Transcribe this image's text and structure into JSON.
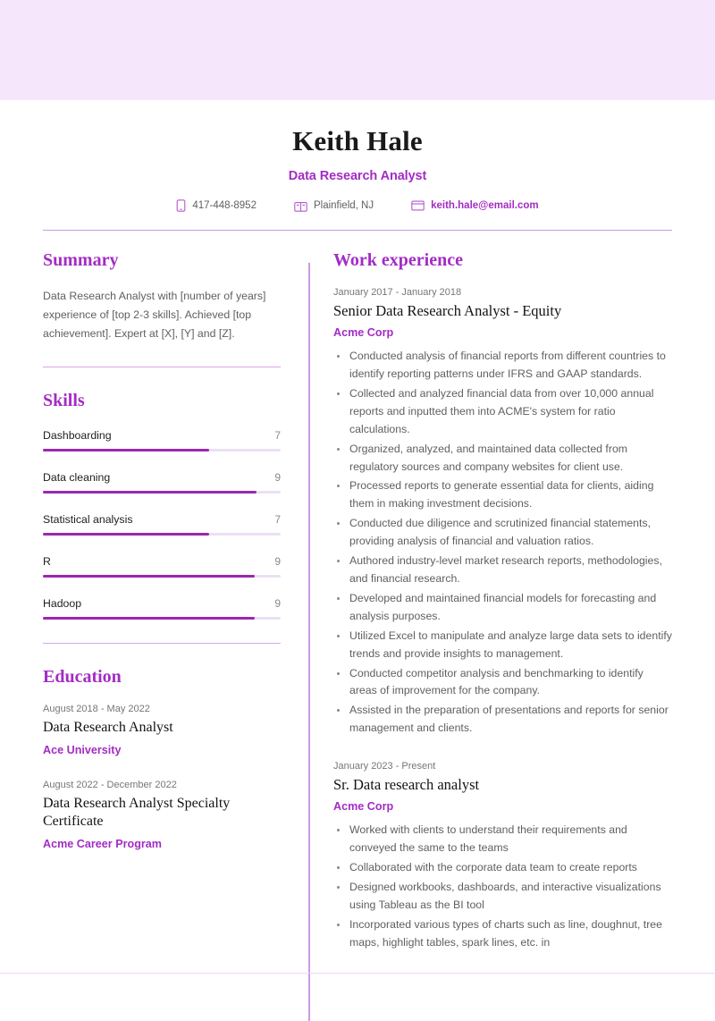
{
  "theme": {
    "accent": "#a32cc4",
    "bar_fill": "#9c27b0",
    "bar_track": "#ece0f3",
    "banner_bg": "#f6e6fb",
    "divider": "#cc9ae0",
    "body_text": "#5f5f5f"
  },
  "header": {
    "full_name": "Keith Hale",
    "job_title": "Data Research Analyst",
    "contacts": [
      {
        "icon": "phone-icon",
        "text": "417-448-8952",
        "accent": false
      },
      {
        "icon": "location-icon",
        "text": "Plainfield, NJ",
        "accent": false
      },
      {
        "icon": "email-icon",
        "text": "keith.hale@email.com",
        "accent": true
      }
    ]
  },
  "summary": {
    "title": "Summary",
    "text": "Data Research Analyst with [number of years] experience of [top 2-3 skills]. Achieved [top achievement]. Expert at [X], [Y] and [Z]."
  },
  "skills": {
    "title": "Skills",
    "max": 10,
    "items": [
      {
        "name": "Dashboarding",
        "value": "7",
        "percent": 70
      },
      {
        "name": "Data cleaning",
        "value": "9",
        "percent": 90
      },
      {
        "name": "Statistical analysis",
        "value": "7",
        "percent": 70
      },
      {
        "name": "R",
        "value": "9",
        "percent": 89
      },
      {
        "name": "Hadoop",
        "value": "9",
        "percent": 89
      }
    ]
  },
  "education": {
    "title": "Education",
    "items": [
      {
        "date": "August 2018 - May 2022",
        "title": "Data Research Analyst",
        "org": "Ace University"
      },
      {
        "date": "August 2022 - December 2022",
        "title": "Data Research Analyst Specialty Certificate",
        "org": "Acme Career Program"
      }
    ]
  },
  "work": {
    "title": "Work experience",
    "jobs": [
      {
        "date": "January 2017 - January 2018",
        "title": "Senior Data Research Analyst - Equity",
        "org": "Acme Corp",
        "bullets": [
          "Conducted analysis of financial reports from different countries to identify reporting patterns under IFRS and GAAP standards.",
          "Collected and analyzed financial data from over 10,000 annual reports and inputted them into ACME's system for ratio calculations.",
          "Organized, analyzed, and maintained data collected from regulatory sources and company websites for client use.",
          "Processed reports to generate essential data for clients, aiding them in making investment decisions.",
          "Conducted due diligence and scrutinized financial statements, providing analysis of financial and valuation ratios.",
          "Authored industry-level market research reports, methodologies, and financial research.",
          "Developed and maintained financial models for forecasting and analysis purposes.",
          "Utilized Excel to manipulate and analyze large data sets to identify trends and provide insights to management.",
          "Conducted competitor analysis and benchmarking to identify areas of improvement for the company.",
          "Assisted in the preparation of presentations and reports for senior management and clients."
        ]
      },
      {
        "date": "January 2023 - Present",
        "title": "Sr. Data research analyst",
        "org": "Acme Corp",
        "bullets": [
          "Worked with clients to understand their requirements and conveyed the same to the teams",
          "Collaborated with the corporate data team to create reports",
          "Designed workbooks, dashboards, and interactive visualizations using Tableau as the BI tool",
          "Incorporated various types of charts such as line, doughnut, tree maps, highlight tables, spark lines, etc. in"
        ]
      }
    ]
  }
}
